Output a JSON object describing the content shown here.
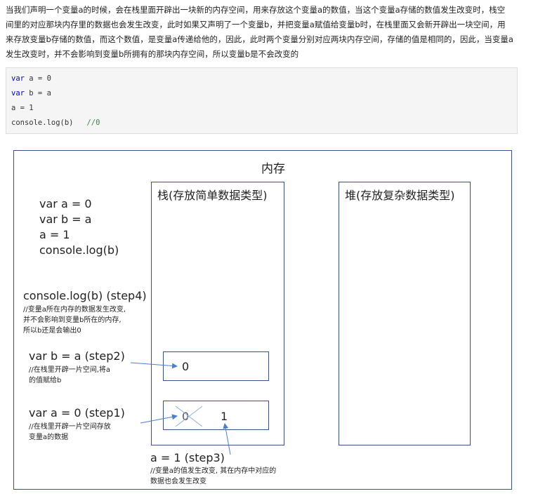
{
  "paragraph": {
    "line1": "当我们声明一个变量a的时候，会在栈里面开辟出一块新的内存空间，用来存放这个变量a的数值，当这个变量a存储的数值发生改变时，栈空",
    "line2": "间里的对应那块内存里的数据也会发生改变，此时如果又声明了一个变量b，并把变量a赋值给变量b时，在栈里面又会新开辟出一块空间，用",
    "line3": "来存放变量b存储的数值，而这个数值，是变量a传递给他的，因此，此时两个变量分别对应两块内存空间，存储的值是相同的，因此，当变量a",
    "line4": "发生改变时，并不会影响到变量b所拥有的那块内存空间，所以变量b是不会改变的"
  },
  "code_block": {
    "line1_kw": "var",
    "line1_rest": " a = 0",
    "line2_kw": "var",
    "line2_rest": " b = a",
    "line3": "a = 1",
    "line4_code": "console.log(b)   ",
    "line4_comment": "//0"
  },
  "diagram": {
    "memory_title": "内存",
    "stack_title": "栈(存放简单数据类型)",
    "heap_title": "堆(存放复杂数据类型)",
    "code_lines": [
      "var a = 0",
      "var b = a",
      "a = 1",
      "console.log(b)"
    ],
    "step4": {
      "label": "console.log(b)  (step4)",
      "note1": "//变量a所在内存的数据发生改变,",
      "note2": "并不会影响到变量b所在的内存,",
      "note3": "所以b还是会输出0"
    },
    "step2": {
      "label": "var b = a  (step2)",
      "note1": "//在栈里开辟一片空间,将a",
      "note2": "的值赋给b"
    },
    "step1": {
      "label": "var a = 0  (step1)",
      "note1": "//在栈里开辟一片空间存放",
      "note2": "变量a的数据"
    },
    "step3": {
      "label": "a = 1  (step3)",
      "note1": "//变量a的值发生改变, 其在内存中对应的",
      "note2": "数据也会发生改变"
    },
    "cell_b_value": "0",
    "cell_a_old_value": "0",
    "cell_a_new_value": "1"
  },
  "colors": {
    "border": "#3a4f8f",
    "arrow": "#4a7fd0",
    "keyword": "#0000cc",
    "comment": "#3a8a3a"
  }
}
